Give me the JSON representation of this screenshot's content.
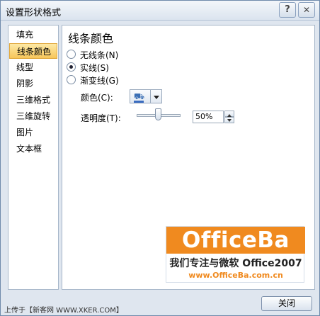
{
  "window": {
    "title": "设置形状格式",
    "help_label": "?",
    "close_label": "✕"
  },
  "nav": {
    "items": [
      {
        "label": "填充"
      },
      {
        "label": "线条颜色",
        "selected": true
      },
      {
        "label": "线型"
      },
      {
        "label": "阴影"
      },
      {
        "label": "三维格式"
      },
      {
        "label": "三维旋转"
      },
      {
        "label": "图片"
      },
      {
        "label": "文本框"
      }
    ]
  },
  "panel": {
    "title": "线条颜色",
    "options": [
      {
        "label": "无线条(N)",
        "checked": false
      },
      {
        "label": "实线(S)",
        "checked": true
      },
      {
        "label": "渐变线(G)",
        "checked": false
      }
    ],
    "color_label": "颜色(C):",
    "line_color": "#3a6cc0",
    "transparency_label": "透明度(T):",
    "transparency_value": "50%"
  },
  "watermark": {
    "logo": "OfficeBa",
    "slogan": "我们专注与微软 Office2007",
    "url": "www.OfficeBa.com.cn"
  },
  "footer": {
    "close_button": "关闭",
    "credit": "上传于【新客网 WWW.XKER.COM】"
  },
  "icons": {
    "fill_bucket": "paint-bucket-icon",
    "dropdown": "chevron-down-icon"
  }
}
